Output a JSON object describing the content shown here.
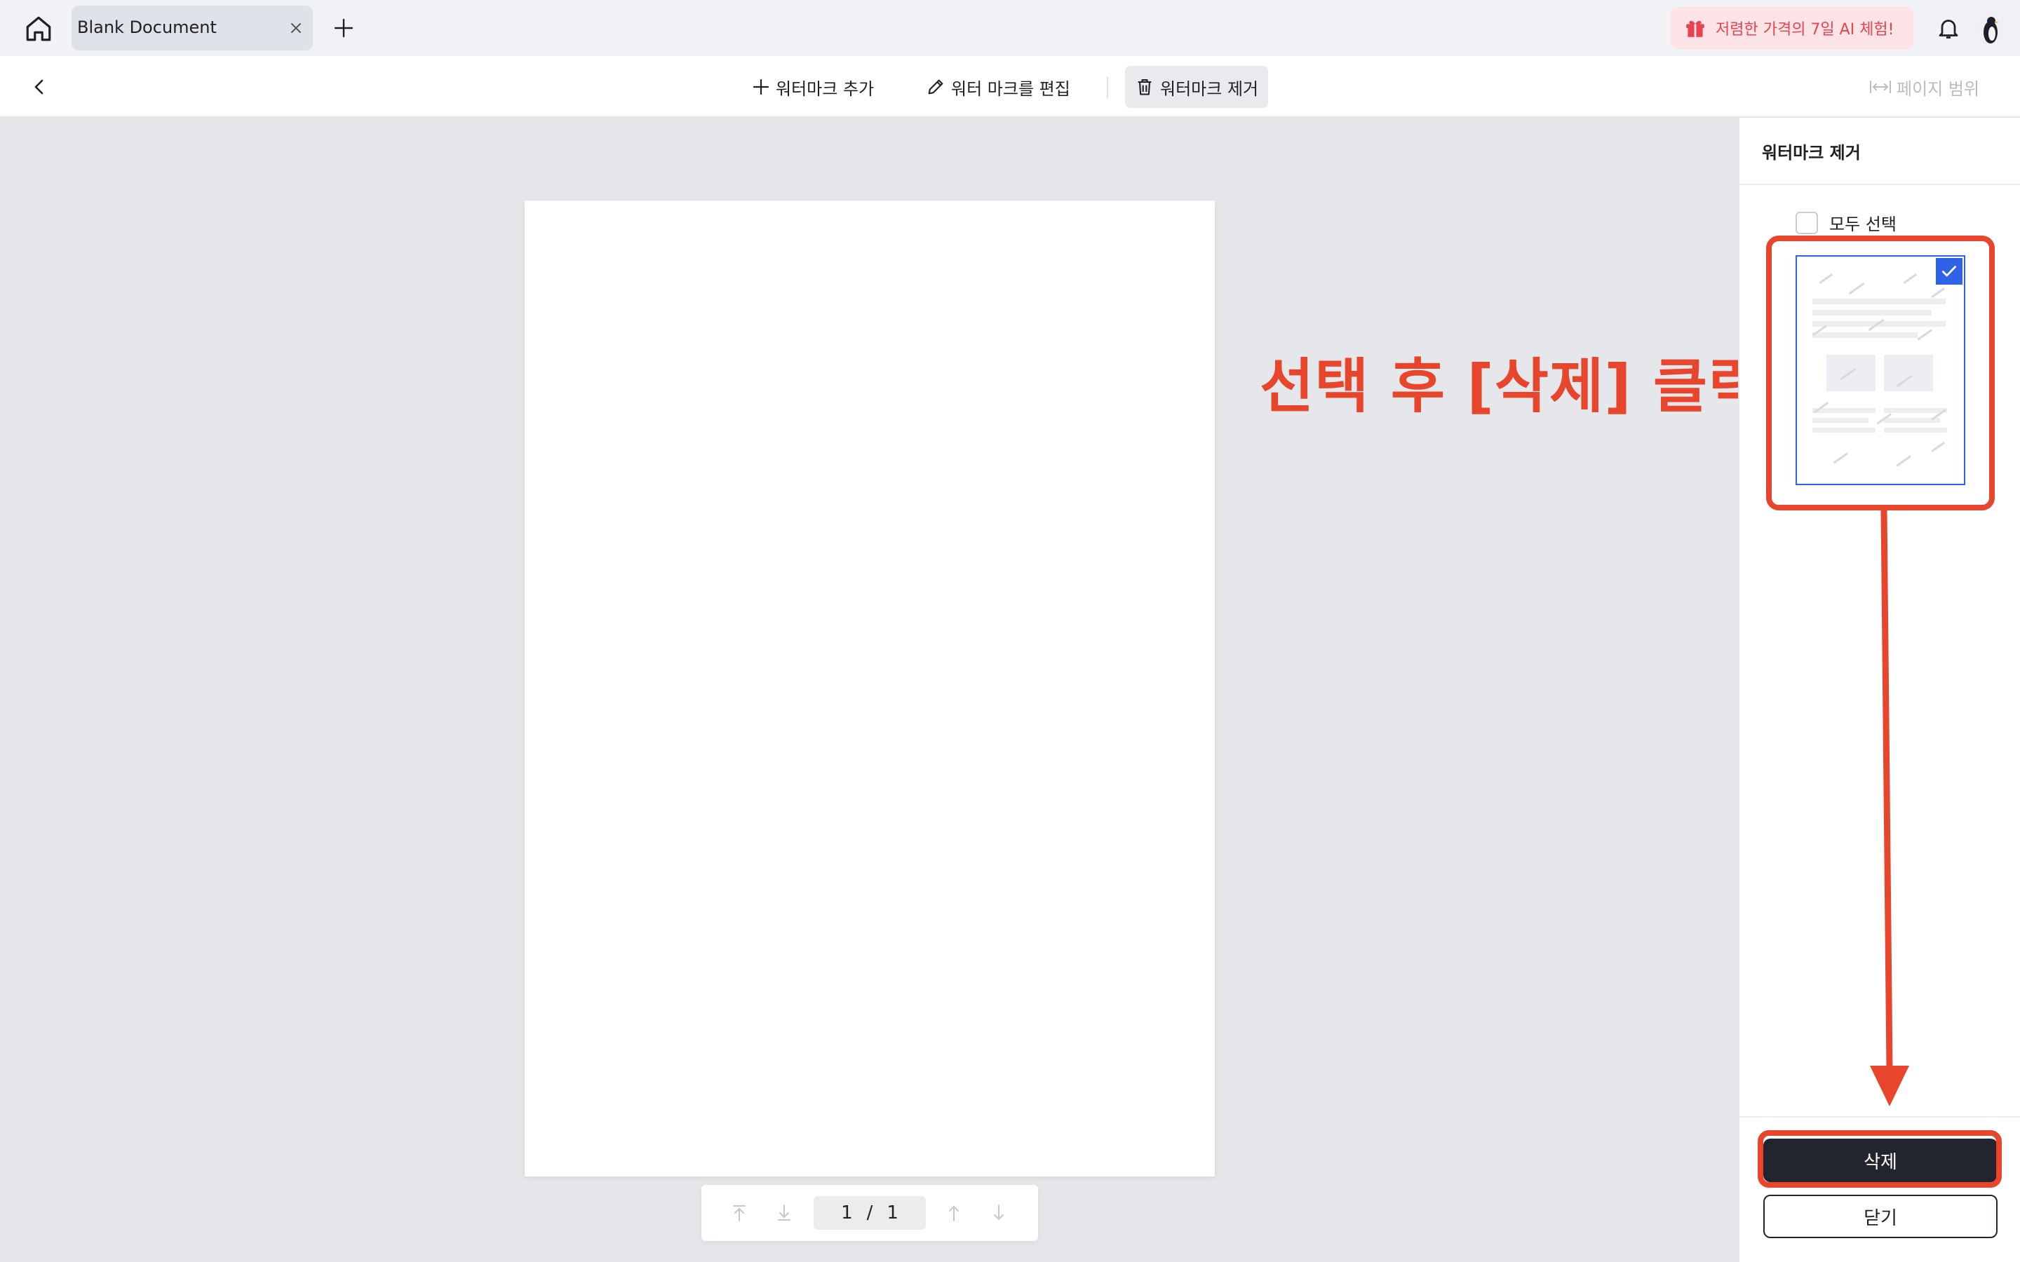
{
  "tabbar": {
    "tab_title": "Blank Document",
    "promo_text": "저렴한 가격의 7일 AI 체험!"
  },
  "toolbar": {
    "add_watermark": "워터마크 추가",
    "edit_watermark": "워터 마크를 편집",
    "remove_watermark": "워터마크 제거",
    "page_range": "페이지 범위"
  },
  "pager": {
    "current": "1",
    "separator": "/",
    "total": "1"
  },
  "panel": {
    "title": "워터마크 제거",
    "select_all": "모두 선택",
    "thumbnail_checked": true,
    "delete_label": "삭제",
    "close_label": "닫기"
  },
  "annotation": {
    "instruction": "선택 후 [삭제] 클릭",
    "color": "#e8452d"
  },
  "colors": {
    "accent_blue": "#2f62e6",
    "primary_dark": "#23252e",
    "promo_red": "#e8444f"
  },
  "icons": [
    "home-icon",
    "close-icon",
    "plus-icon",
    "gift-icon",
    "bell-icon",
    "chevron-left-icon",
    "pencil-icon",
    "trash-icon",
    "page-range-icon",
    "check-icon",
    "arrow-to-top-icon",
    "arrow-to-bottom-icon",
    "arrow-up-icon",
    "arrow-down-icon"
  ]
}
